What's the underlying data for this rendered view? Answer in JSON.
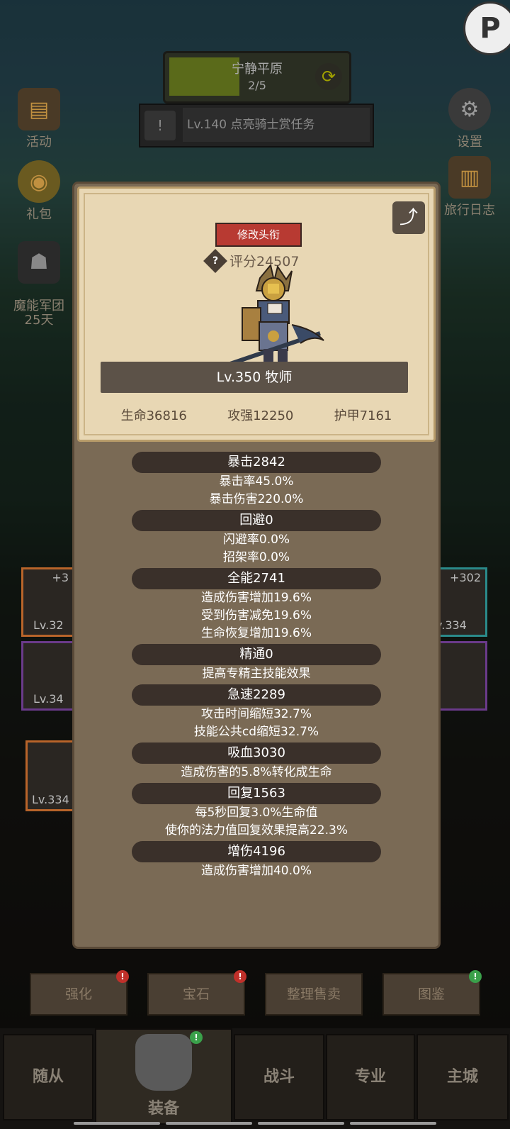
{
  "hud": {
    "zone_name": "宁静平原",
    "zone_progress": "2/5",
    "zone_progress_fraction": 0.4,
    "quest_text": "Lv.140 点亮骑士赏任务",
    "refresh_icon": "refresh-icon"
  },
  "left_menu": [
    {
      "label": "活动",
      "icon": "book-icon"
    },
    {
      "label": "礼包",
      "icon": "coin-icon"
    },
    {
      "label": "魔能军团\n25天",
      "icon": "helmet-icon"
    }
  ],
  "right_menu": [
    {
      "label": "设置",
      "icon": "gear-icon"
    },
    {
      "label": "旅行日志",
      "icon": "journal-icon"
    }
  ],
  "profile": {
    "edit_title_label": "修改头衔",
    "score_label": "评分24507",
    "name": "Lv.350 牧师",
    "hp": "生命36816",
    "atk": "攻强12250",
    "armor": "护甲7161",
    "share_icon": "share-icon"
  },
  "attributes": [
    {
      "header": "暴击2842",
      "lines": [
        "暴击率45.0%",
        "暴击伤害220.0%"
      ]
    },
    {
      "header": "回避0",
      "lines": [
        "闪避率0.0%",
        "招架率0.0%"
      ]
    },
    {
      "header": "全能2741",
      "lines": [
        "造成伤害增加19.6%",
        "受到伤害减免19.6%",
        "生命恢复增加19.6%"
      ]
    },
    {
      "header": "精通0",
      "lines": [
        "提高专精主技能效果"
      ]
    },
    {
      "header": "急速2289",
      "lines": [
        "攻击时间缩短32.7%",
        "技能公共cd缩短32.7%"
      ]
    },
    {
      "header": "吸血3030",
      "lines": [
        "造成伤害的5.8%转化成生命"
      ]
    },
    {
      "header": "回复1563",
      "lines": [
        "每5秒回复3.0%生命值",
        "使你的法力值回复效果提高22.3%"
      ]
    },
    {
      "header": "增伤4196",
      "lines": [
        "造成伤害增加40.0%"
      ]
    }
  ],
  "items": {
    "slot1_lv": "Lv.32",
    "slot1_plus": "+3",
    "slot2_lv": "Lv.34",
    "slot3_lv": "v.334",
    "slot3_plus": "+302",
    "slot4_lv": "Lv.334"
  },
  "actions": {
    "enhance": "强化",
    "gems": "宝石",
    "sort_sell": "整理售卖",
    "codex": "图鉴",
    "alert_mark": "!"
  },
  "nav": {
    "followers": "随从",
    "equipment": "装备",
    "battle": "战斗",
    "profession": "专业",
    "main_city": "主城"
  },
  "colors": {
    "card_bg": "#7a6a55",
    "header_parchment": "#e8d7b4",
    "edit_button": "#b83a32",
    "attr_header": "#3a302a"
  }
}
